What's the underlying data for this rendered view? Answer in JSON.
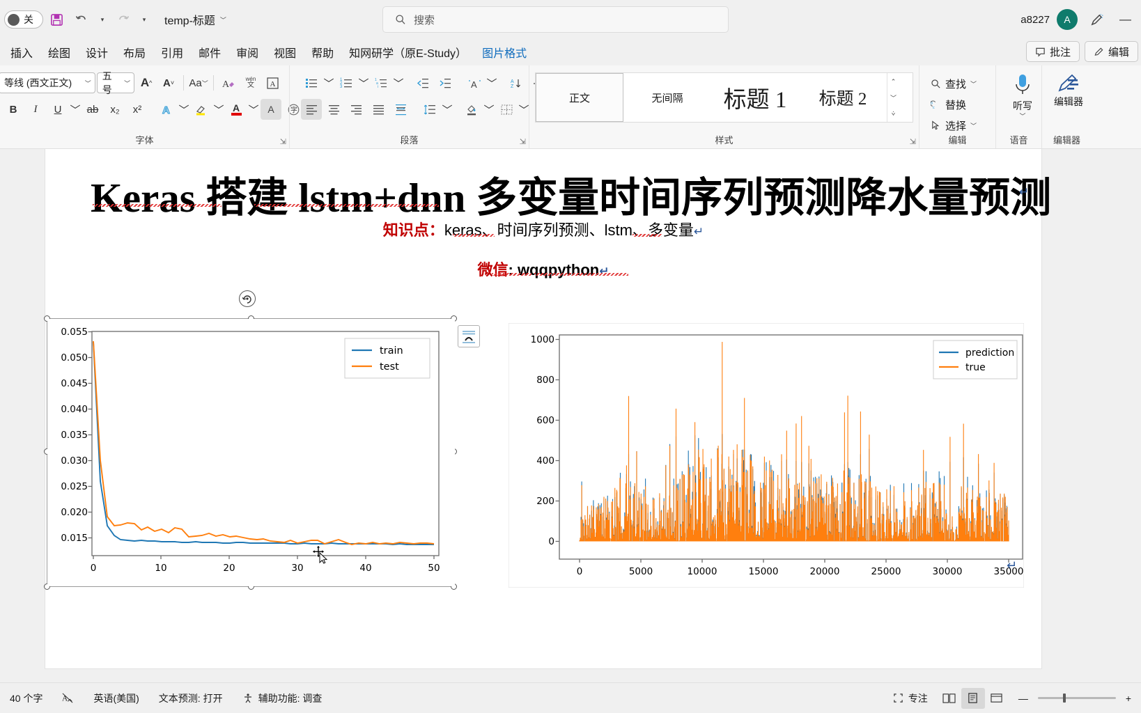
{
  "titlebar": {
    "autosave_label": "关",
    "save_icon": "save-icon",
    "undo_icon": "undo-icon",
    "redo_icon": "redo-icon",
    "more_icon": "chevron-down-icon",
    "document_name": "temp-标题",
    "username": "a8227",
    "avatar_initial": "A",
    "pen_icon": "pen-icon",
    "minimize_label": "—"
  },
  "search": {
    "placeholder": "搜索",
    "icon": "search-icon"
  },
  "tabs": [
    {
      "label": "插入",
      "active": false
    },
    {
      "label": "绘图",
      "active": false
    },
    {
      "label": "设计",
      "active": false
    },
    {
      "label": "布局",
      "active": false
    },
    {
      "label": "引用",
      "active": false
    },
    {
      "label": "邮件",
      "active": false
    },
    {
      "label": "审阅",
      "active": false
    },
    {
      "label": "视图",
      "active": false
    },
    {
      "label": "帮助",
      "active": false
    },
    {
      "label": "知网研学（原E-Study）",
      "active": false
    },
    {
      "label": "图片格式",
      "active": true
    }
  ],
  "tab_actions": {
    "comments": "批注",
    "comments_icon": "comment-icon",
    "editing": "编辑",
    "editing_icon": "pencil-icon"
  },
  "ribbon": {
    "font_group": {
      "label": "字体",
      "font_name": "等线 (西文正文)",
      "font_size": "五号",
      "grow_icon": "grow-font-icon",
      "shrink_icon": "shrink-font-icon",
      "change_case_icon": "change-case-icon",
      "clear_format_icon": "clear-formatting-icon",
      "phonetic_icon": "phonetic-guide-icon",
      "border_icon": "character-border-icon",
      "bold": "B",
      "italic": "I",
      "underline": "U",
      "strike_icon": "strikethrough-icon",
      "subscript": "x₂",
      "superscript": "x²",
      "text_effects_icon": "text-effects-icon",
      "highlight_icon": "highlight-icon",
      "font_color_icon": "font-color-icon",
      "shading_icon": "character-shading-icon",
      "enclose_icon": "enclose-character-icon"
    },
    "paragraph_group": {
      "label": "段落",
      "bullets_icon": "bullet-list-icon",
      "numbering_icon": "numbered-list-icon",
      "multilevel_icon": "multilevel-list-icon",
      "decrease_indent_icon": "decrease-indent-icon",
      "increase_indent_icon": "increase-indent-icon",
      "chinese_layout_icon": "chinese-layout-icon",
      "sort_icon": "sort-icon",
      "show_marks_icon": "show-formatting-marks-icon",
      "align_left_icon": "align-left-icon",
      "align_center_icon": "align-center-icon",
      "align_right_icon": "align-right-icon",
      "justify_icon": "justify-icon",
      "distribute_icon": "distribute-icon",
      "line_spacing_icon": "line-spacing-icon",
      "shading_icon": "paragraph-shading-icon",
      "borders_icon": "borders-icon"
    },
    "styles_group": {
      "label": "样式",
      "items": [
        {
          "label": "正文",
          "selected": true
        },
        {
          "label": "无间隔",
          "selected": false
        },
        {
          "label": "标题 1",
          "selected": false
        },
        {
          "label": "标题 2",
          "selected": false
        }
      ]
    },
    "editing_group": {
      "label": "编辑",
      "find": "查找",
      "find_icon": "search-icon",
      "replace": "替换",
      "replace_icon": "replace-icon",
      "select": "选择",
      "select_icon": "cursor-arrow-icon"
    },
    "voice_group": {
      "label": "语音",
      "dictate": "听写",
      "dictate_icon": "microphone-icon"
    },
    "editor_group": {
      "label": "编辑器",
      "editor": "编辑器",
      "editor_icon": "editor-pen-icon"
    }
  },
  "document": {
    "title": "Keras 搭建 lstm+dnn 多变量时间序列预测降水量预测",
    "knowledge_label": "知识点：",
    "knowledge_text": "keras、时间序列预测、lstm、多变量",
    "wechat_label": "微信",
    "wechat_text": ": wqqpython",
    "paragraph_mark": "↵"
  },
  "colors": {
    "train_line": "#1f77b4",
    "test_line": "#ff7f0e",
    "accent": "#0f6cbd",
    "avatar": "#0f7b6c",
    "title_red": "#c00000"
  },
  "chart_data": [
    {
      "type": "line",
      "name": "loss-curve",
      "title": "",
      "xlabel": "",
      "ylabel": "",
      "xlim": [
        0,
        50
      ],
      "ylim": [
        0.0135,
        0.0557
      ],
      "xticks": [
        "0",
        "10",
        "20",
        "30",
        "40",
        "50"
      ],
      "yticks": [
        "0.015",
        "0.020",
        "0.025",
        "0.030",
        "0.035",
        "0.040",
        "0.045",
        "0.050",
        "0.055"
      ],
      "legend_position": "upper right",
      "grid": false,
      "series": [
        {
          "name": "train",
          "color": "#1f77b4",
          "values": [
            0.0535,
            0.0265,
            0.0179,
            0.0156,
            0.0148,
            0.0146,
            0.01455,
            0.01462,
            0.01455,
            0.01452,
            0.01448,
            0.01445,
            0.01444,
            0.01443,
            0.01442,
            0.01443,
            0.01441,
            0.0144,
            0.0144,
            0.01439,
            0.01439,
            0.01441,
            0.0144,
            0.01439,
            0.01438,
            0.01437,
            0.01437,
            0.01438,
            0.01437,
            0.01436,
            0.01436,
            0.01437,
            0.01436,
            0.01436,
            0.01435,
            0.01437,
            0.01436,
            0.01435,
            0.01435,
            0.01434,
            0.01434,
            0.01435,
            0.01434,
            0.01434,
            0.01433,
            0.01434,
            0.01433,
            0.01433,
            0.01432,
            0.01432,
            0.01432
          ]
        },
        {
          "name": "test",
          "color": "#ff7f0e",
          "values": [
            0.0537,
            0.0305,
            0.0196,
            0.0178,
            0.018,
            0.0183,
            0.0182,
            0.017,
            0.0176,
            0.0168,
            0.0172,
            0.0166,
            0.0174,
            0.0172,
            0.0156,
            0.0158,
            0.0159,
            0.0162,
            0.0158,
            0.0161,
            0.0156,
            0.0157,
            0.0155,
            0.0153,
            0.0152,
            0.0153,
            0.0149,
            0.0148,
            0.0147,
            0.015,
            0.0146,
            0.0148,
            0.0151,
            0.015,
            0.0145,
            0.0148,
            0.0151,
            0.0147,
            0.0144,
            0.0146,
            0.0145,
            0.0147,
            0.0145,
            0.0146,
            0.0145,
            0.0147,
            0.0146,
            0.0145,
            0.0146,
            0.0146,
            0.0145
          ]
        }
      ]
    },
    {
      "type": "line",
      "name": "prediction-vs-true",
      "title": "",
      "xlabel": "",
      "ylabel": "",
      "xlim": [
        0,
        36000
      ],
      "ylim": [
        -60,
        1040
      ],
      "xticks": [
        "0",
        "5000",
        "10000",
        "15000",
        "20000",
        "25000",
        "30000",
        "35000"
      ],
      "yticks": [
        "0",
        "200",
        "400",
        "600",
        "800",
        "1000"
      ],
      "legend_position": "upper right",
      "grid": false,
      "series": [
        {
          "name": "prediction",
          "color": "#1f77b4",
          "peak_values": [
            300,
            420,
            500,
            580,
            430,
            400,
            360,
            490,
            350,
            420,
            300
          ]
        },
        {
          "name": "true",
          "color": "#ff7f0e",
          "peak_values": [
            300,
            600,
            430,
            1000,
            880,
            530,
            680,
            560,
            540,
            530,
            420
          ]
        }
      ]
    }
  ],
  "statusbar": {
    "word_count": "40 个字",
    "proofing_icon": "proofing-icon",
    "language": "英语(美国)",
    "text_prediction": "文本预测: 打开",
    "accessibility": "辅助功能: 调查",
    "accessibility_icon": "accessibility-icon",
    "focus": "专注",
    "focus_icon": "focus-icon",
    "view_read_icon": "read-mode-icon",
    "view_print_icon": "print-layout-icon",
    "view_web_icon": "web-layout-icon",
    "zoom_out": "—",
    "zoom_in": "+"
  }
}
